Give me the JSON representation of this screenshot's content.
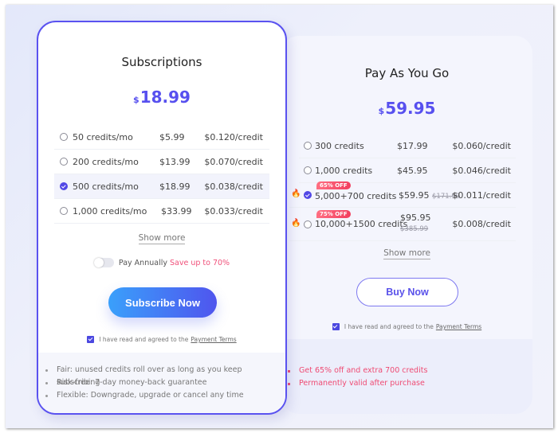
{
  "subscriptions": {
    "title": "Subscriptions",
    "currency_symbol": "$",
    "price": "18.99",
    "plans": [
      {
        "credits": "50 credits/mo",
        "price": "$5.99",
        "unit": "$0.120/credit",
        "selected": false
      },
      {
        "credits": "200 credits/mo",
        "price": "$13.99",
        "unit": "$0.070/credit",
        "selected": false
      },
      {
        "credits": "500 credits/mo",
        "price": "$18.99",
        "unit": "$0.038/credit",
        "selected": true
      },
      {
        "credits": "1,000 credits/mo",
        "price": "$33.99",
        "unit": "$0.033/credit",
        "selected": false
      }
    ],
    "show_more": "Show more",
    "pay_annually": "Pay Annually",
    "save_text": "Save up to 70%",
    "pay_annually_on": false,
    "cta": "Subscribe Now",
    "agree_text": "I have read and agreed to the",
    "agree_link": "Payment Terms",
    "agree_checked": true,
    "benefits": [
      "Fair: unused credits roll over as long as you keep subscribing",
      "Risk-free: 7-day money-back guarantee",
      "Flexible: Downgrade, upgrade or cancel any time"
    ]
  },
  "payg": {
    "title": "Pay As You Go",
    "currency_symbol": "$",
    "price": "59.95",
    "plans": [
      {
        "credits": "300 credits",
        "price": "$17.99",
        "unit": "$0.060/credit",
        "selected": false
      },
      {
        "credits": "1,000 credits",
        "price": "$45.95",
        "unit": "$0.046/credit",
        "selected": false
      },
      {
        "credits": "5,000+700 credits",
        "price": "$59.95",
        "old_price": "$171.99",
        "unit": "$0.011/credit",
        "badge": "65% OFF",
        "hot": true,
        "selected": true
      },
      {
        "credits": "10,000+1500 credits",
        "price": "$95.95",
        "old_price": "$385.99",
        "unit": "$0.008/credit",
        "badge": "75% OFF",
        "hot": true,
        "selected": false
      }
    ],
    "show_more": "Show more",
    "cta": "Buy Now",
    "agree_text": "I have read and agreed to the",
    "agree_link": "Payment Terms",
    "agree_checked": true,
    "benefits": [
      "Get 65% off and extra 700 credits",
      "Permanently valid after purchase"
    ]
  },
  "colors": {
    "accent": "#5750ef",
    "promo": "#ef4b73",
    "gradient_start": "#3aa0fb",
    "gradient_end": "#4f55ee"
  }
}
